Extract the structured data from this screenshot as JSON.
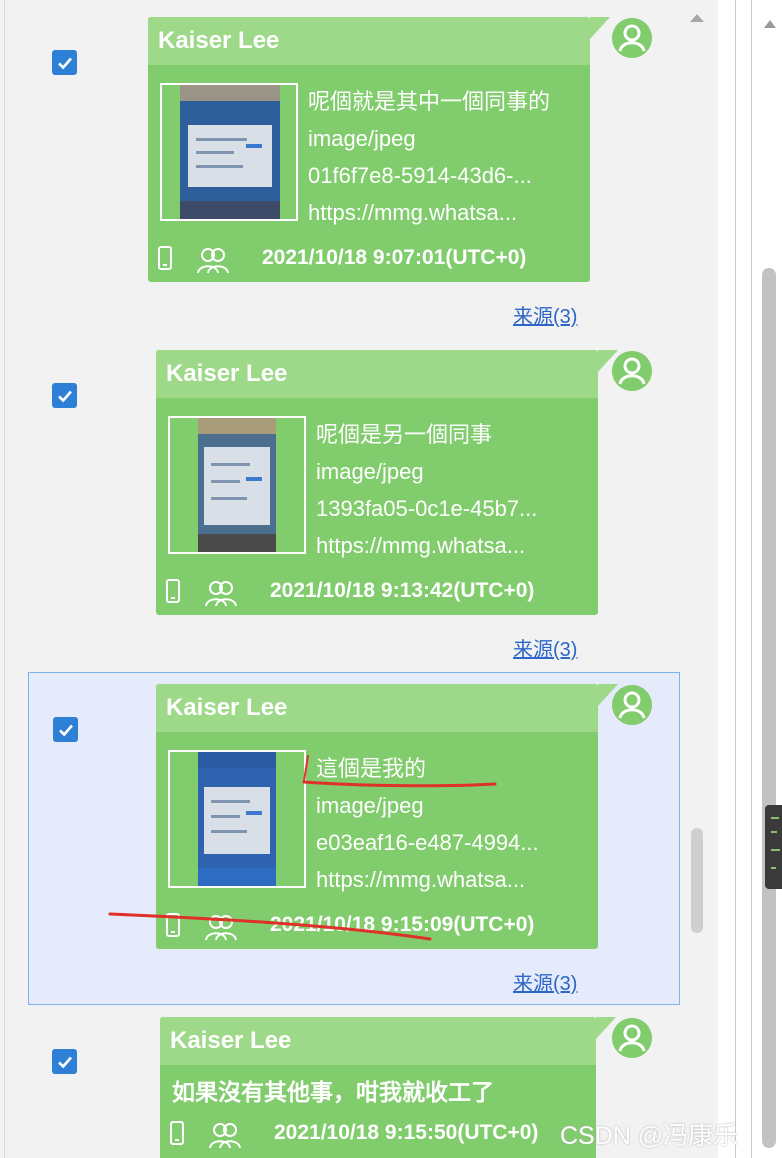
{
  "messages": [
    {
      "sender": "Kaiser Lee",
      "checked": true,
      "caption": "呢個就是其中一個同事的",
      "mime": "image/jpeg",
      "file_id": "01f6f7e8-5914-43d6-...",
      "url": "https://mmg.whatsa...",
      "timestamp": "2021/10/18 9:07:01(UTC+0)",
      "source_link": "来源(3)"
    },
    {
      "sender": "Kaiser Lee",
      "checked": true,
      "caption": "呢個是另一個同事",
      "mime": "image/jpeg",
      "file_id": "1393fa05-0c1e-45b7...",
      "url": "https://mmg.whatsa...",
      "timestamp": "2021/10/18 9:13:42(UTC+0)",
      "source_link": "来源(3)"
    },
    {
      "sender": "Kaiser Lee",
      "checked": true,
      "selected": true,
      "caption": "這個是我的",
      "mime": "image/jpeg",
      "file_id": "e03eaf16-e487-4994...",
      "url": "https://mmg.whatsa...",
      "timestamp": "2021/10/18 9:15:09(UTC+0)",
      "source_link": "来源(3)"
    },
    {
      "sender": "Kaiser Lee",
      "checked": true,
      "text": "如果沒有其他事，咁我就收工了",
      "timestamp": "2021/10/18 9:15:50(UTC+0)"
    }
  ],
  "icons": {
    "checkbox": "check-icon",
    "device": "phone-icon",
    "group": "group-icon",
    "avatar": "user-avatar-icon"
  },
  "colors": {
    "bubble": "#81cc6c",
    "bubble_header": "#9ed98a",
    "checkbox": "#2e7fd6",
    "link": "#2b66c8",
    "selected_row": "#e6ebfb",
    "annotation": "#e0302a"
  },
  "watermark": "CSDN @冯康乐"
}
